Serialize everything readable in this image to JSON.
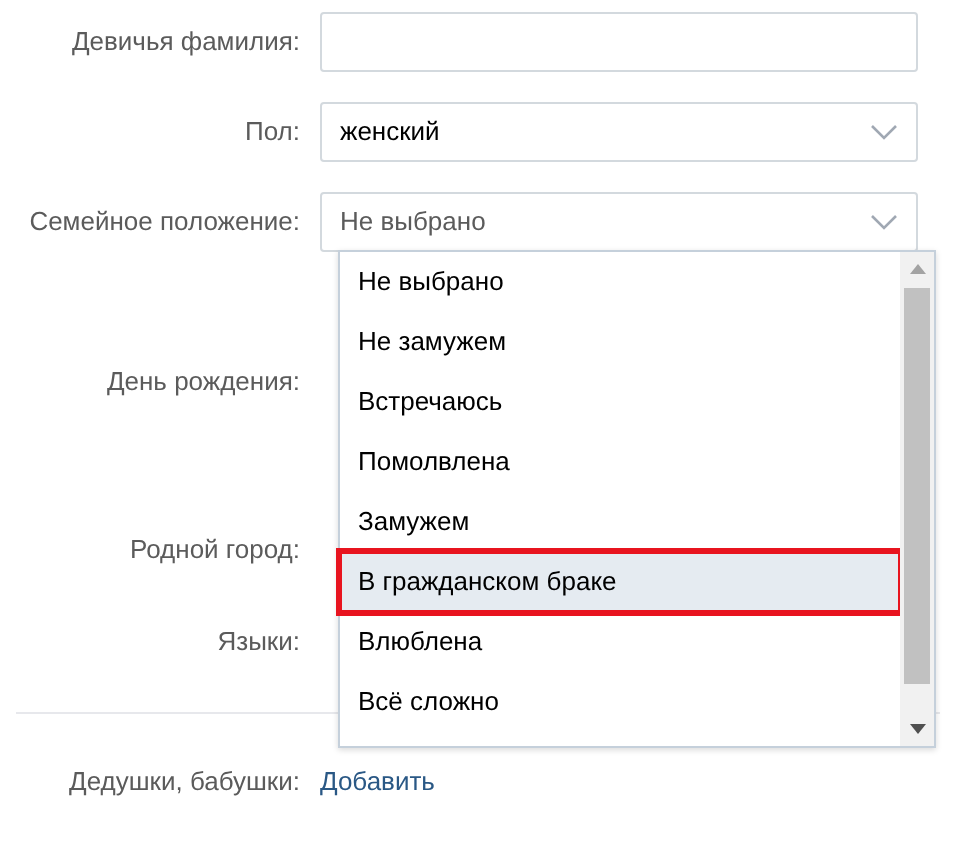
{
  "fields": [
    {
      "label": "Девичья фамилия:",
      "kind": "text"
    },
    {
      "label": "Пол:",
      "kind": "select",
      "value": "женский"
    },
    {
      "label": "Семейное положение:",
      "kind": "select",
      "value": "Не выбрано",
      "placeholder_style": true
    }
  ],
  "hidden_rows": [
    {
      "label": "День рождения:"
    },
    {
      "label": "Родной город:"
    },
    {
      "label": "Языки:"
    }
  ],
  "dropdown": {
    "expanded": true,
    "options": [
      {
        "label": "Не выбрано",
        "selected": false
      },
      {
        "label": "Не замужем",
        "selected": false
      },
      {
        "label": "Встречаюсь",
        "selected": false
      },
      {
        "label": "Помолвлена",
        "selected": false
      },
      {
        "label": "Замужем",
        "selected": false
      },
      {
        "label": "В гражданском браке",
        "selected": true
      },
      {
        "label": "Влюблена",
        "selected": false
      },
      {
        "label": "Всё сложно",
        "selected": false
      }
    ]
  },
  "grandparents": {
    "label": "Дедушки, бабушки:",
    "link": "Добавить"
  }
}
